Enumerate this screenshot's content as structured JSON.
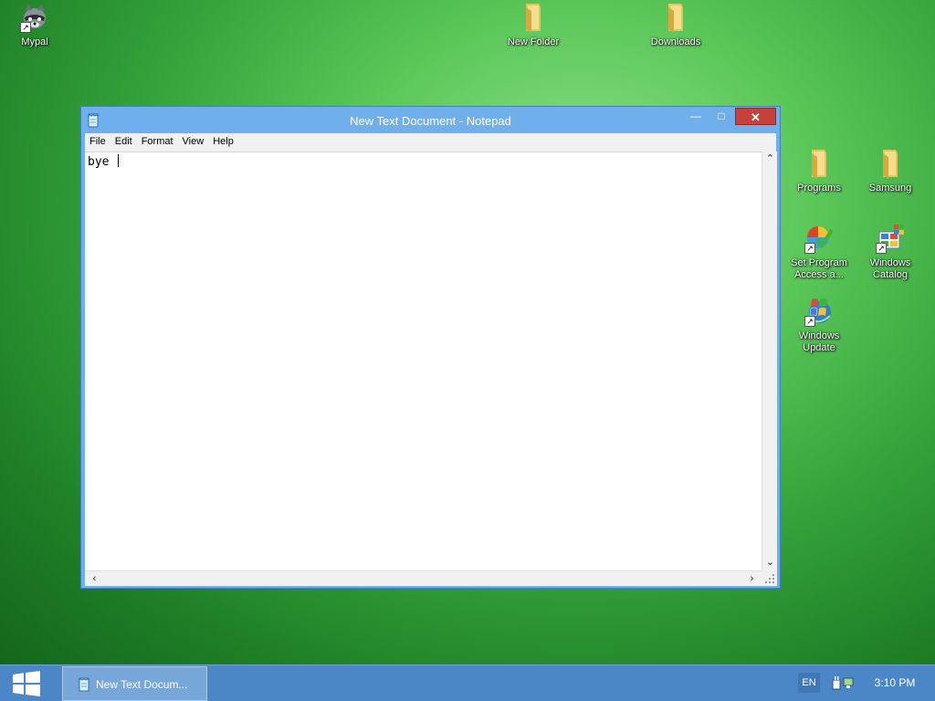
{
  "desktop": {
    "icons": [
      {
        "label": "Mypal",
        "icon": "raccoon-app-icon"
      },
      {
        "label": "New Folder",
        "icon": "folder-icon"
      },
      {
        "label": "Downloads",
        "icon": "folder-icon"
      },
      {
        "label": "Programs",
        "icon": "folder-icon"
      },
      {
        "label": "Samsung",
        "icon": "folder-icon"
      },
      {
        "label": "Set Program Access a...",
        "icon": "program-access-icon"
      },
      {
        "label": "Windows Catalog",
        "icon": "windows-catalog-icon"
      },
      {
        "label": "Windows Update",
        "icon": "windows-update-icon"
      }
    ]
  },
  "notepad": {
    "title": "New Text Document - Notepad",
    "menu": [
      "File",
      "Edit",
      "Format",
      "View",
      "Help"
    ],
    "content": "bye ",
    "buttons": {
      "minimize": "—",
      "maximize": "□",
      "close": "✕"
    }
  },
  "taskbar": {
    "task_label": "New Text Docum...",
    "language": "EN",
    "clock": "3:10 PM"
  },
  "colors": {
    "taskbar": "#4b86c6",
    "window_frame": "#6fb0ec",
    "close_button": "#c7413b",
    "desktop_green": "#34a23a"
  }
}
